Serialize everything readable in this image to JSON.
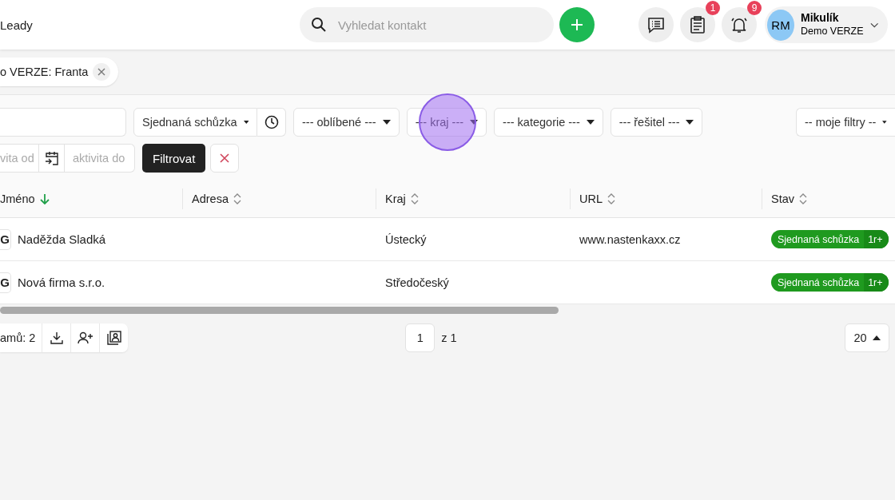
{
  "header": {
    "title": "Leady",
    "search": {
      "placeholder": "Vyhledat kontakt"
    },
    "actions": [
      {
        "kind": "messages"
      },
      {
        "kind": "tasks",
        "badge": "1"
      },
      {
        "kind": "alerts",
        "badge": "9"
      }
    ],
    "user": {
      "initials": "RM",
      "name": "Mikulík",
      "company": "Demo VERZE"
    }
  },
  "filter_chip": {
    "label": "o VERZE: Franta"
  },
  "filters": {
    "row1": [
      {
        "kind": "input"
      },
      {
        "kind": "status-select",
        "value": "Sjednaná schůzka"
      },
      {
        "kind": "select",
        "value": "--- oblíbené ---"
      },
      {
        "kind": "select",
        "value": "--- kraj ---"
      },
      {
        "kind": "select",
        "value": "--- kategorie ---"
      },
      {
        "kind": "select",
        "value": "--- řešitel ---"
      }
    ],
    "saved_filters": {
      "value": "-- moje filtry --"
    },
    "date_from": {
      "placeholder": "vita od"
    },
    "date_to": {
      "placeholder": "aktivita do"
    },
    "submit": "Filtrovat"
  },
  "table": {
    "columns": [
      {
        "label": "Jméno",
        "sorted": true
      },
      {
        "label": "Adresa",
        "sorted": false
      },
      {
        "label": "Kraj",
        "sorted": false
      },
      {
        "label": "URL",
        "sorted": false
      },
      {
        "label": "Stav",
        "sorted": false
      }
    ],
    "rows": [
      {
        "source": "G",
        "name": "Naděžda Sladká",
        "kraj": "Ústecký",
        "url": "www.nastenkaxx.cz",
        "status": "Sjednaná schůzka",
        "status_tag": "1r+"
      },
      {
        "source": "G",
        "name": "Nová firma s.r.o.",
        "kraj": "Středočeský",
        "status": "Sjednaná schůzka",
        "status_tag": "1r+"
      }
    ]
  },
  "footer": {
    "count": "amů: 2",
    "page": "1",
    "page_total": "z 1",
    "per_page": "20"
  },
  "click_highlight": true
}
